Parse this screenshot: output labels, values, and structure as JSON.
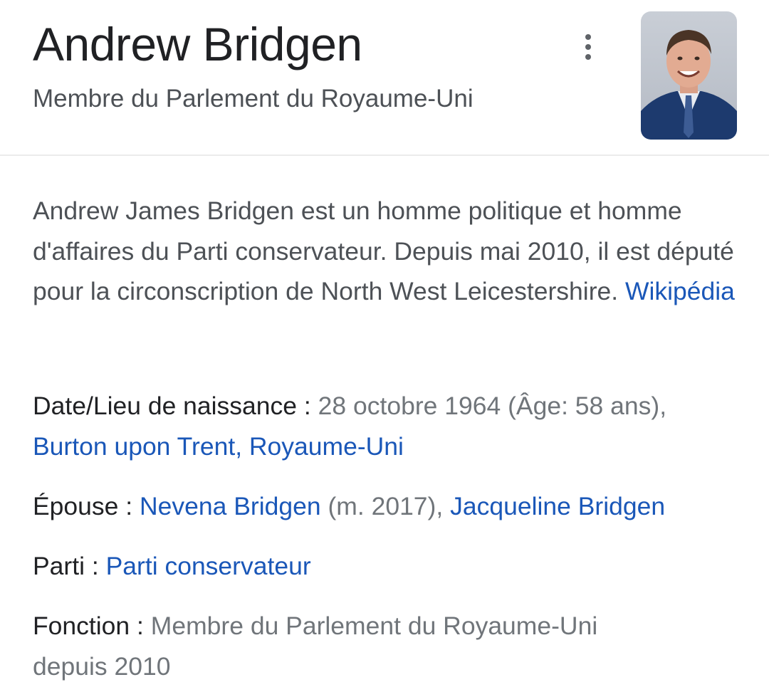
{
  "header": {
    "title": "Andrew Bridgen",
    "subtitle": "Membre du Parlement du Royaume-Uni",
    "more_icon": "more-vert-icon",
    "photo_icon": "person-portrait-icon"
  },
  "description": {
    "text": "Andrew James Bridgen est un homme politique et homme d'affaires du Parti conservateur. Depuis mai 2010, il est député pour la circonscription de North West Leicestershire.",
    "source_link": "Wikipédia"
  },
  "facts": {
    "birth": {
      "label": "Date/Lieu de naissance",
      "separator": " : ",
      "value": "28 octobre 1964 (Âge: 58 ans),",
      "place_link": "Burton upon Trent, Royaume-Uni"
    },
    "spouse": {
      "label": "Épouse",
      "separator": " : ",
      "link1": "Nevena Bridgen",
      "mid": " (m. 2017), ",
      "link2": "Jacqueline Bridgen"
    },
    "party": {
      "label": "Parti",
      "separator": " : ",
      "link": "Parti conservateur"
    },
    "office": {
      "label": "Fonction",
      "separator": " : ",
      "value": "Membre du Parlement du Royaume-Uni depuis 2010"
    }
  },
  "colors": {
    "link": "#1a57b8",
    "title": "#202124",
    "secondary": "#4d5156",
    "muted": "#70757a"
  }
}
